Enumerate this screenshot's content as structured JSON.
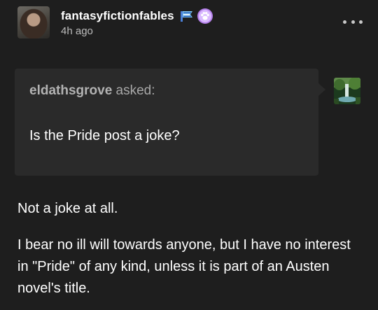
{
  "post": {
    "blog_name": "fantasyfictionfables",
    "timestamp": "4h ago",
    "badges": [
      "flag-badge-icon",
      "paw-badge-icon"
    ],
    "ask": {
      "asker": "eldathsgrove",
      "asked_label": "asked:",
      "question": "Is the Pride post a joke?"
    },
    "answer": [
      "Not a joke at all.",
      "I bear no ill will towards anyone, but I have no interest in \"Pride\" of any kind, unless it is part of an Austen novel's title."
    ]
  },
  "colors": {
    "background": "#1e1e1e",
    "ask_box": "#2a2a2a",
    "text": "#ffffff",
    "muted_text": "#bdbdbd",
    "badge_purple": "#b37fe8"
  }
}
